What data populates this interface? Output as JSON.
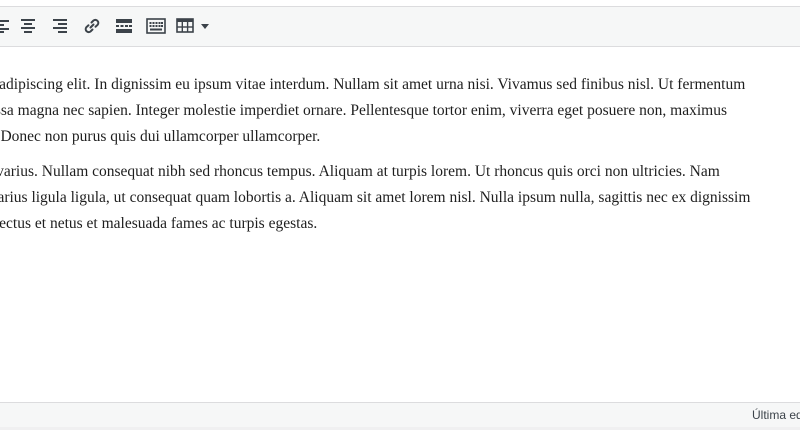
{
  "toolbar": {
    "buttons": [
      {
        "icon": "align-left-icon",
        "label": "Alinear a la izquierda"
      },
      {
        "icon": "align-center-icon",
        "label": "Alinear al centro"
      },
      {
        "icon": "align-right-icon",
        "label": "Alinear a la derecha"
      },
      {
        "icon": "link-icon",
        "label": "Insertar/editar enlace"
      },
      {
        "icon": "read-more-icon",
        "label": "Insertar etiqueta Leer más"
      },
      {
        "icon": "keyboard-icon",
        "label": "Barra de herramientas"
      },
      {
        "icon": "table-icon",
        "label": "Tabla"
      }
    ]
  },
  "content": {
    "paragraphs": [
      {
        "lines": [
          "ctetur adipiscing elit. In dignissim eu ipsum vitae interdum. Nullam sit amet urna nisi. Vivamus sed finibus nisl. Ut fermentum",
          "m massa magna nec sapien. Integer molestie imperdiet ornare. Pellentesque tortor enim, viverra eget posuere non, maximus",
          "uctus. Donec non purus quis dui ullamcorper ullamcorper."
        ]
      },
      {
        "lines": [
          "ue ac varius. Nullam consequat nibh sed rhoncus tempus. Aliquam at turpis lorem. Ut rhoncus quis orci non ultricies. Nam",
          "ante varius ligula ligula, ut consequat quam lobortis a. Aliquam sit amet lorem nisl. Nulla ipsum nulla, sagittis nec ex dignissim",
          "ue senectus et netus et malesuada fames ac turpis egestas."
        ]
      }
    ]
  },
  "status_bar": {
    "text": "Última edición"
  },
  "colors": {
    "toolbar_bg": "#f6f7f7",
    "border": "#dcdcde",
    "icon": "#3c434a",
    "text": "#1e1e1e"
  }
}
